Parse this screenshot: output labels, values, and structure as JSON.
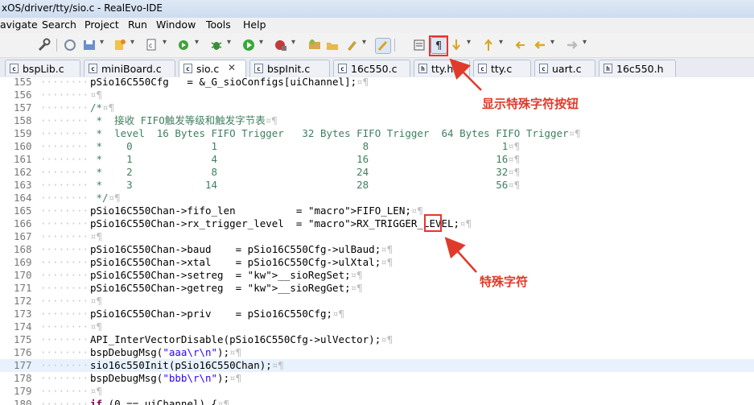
{
  "window": {
    "title": "xOS/driver/tty/sio.c - RealEvo-IDE"
  },
  "menu": [
    "avigate",
    "Search",
    "Project",
    "Run",
    "Window",
    "Tools",
    "Help"
  ],
  "toolbar": {
    "icons": [
      "wrench-icon",
      "save-icon",
      "new-icon",
      "copy-icon",
      "refresh-icon",
      "bug-icon",
      "run-icon",
      "record-icon",
      "package-icon",
      "open-icon",
      "paint-icon",
      "pen-icon",
      "block-icon",
      "pilcrow-icon",
      "arrow-down-icon",
      "nav-icon",
      "back-icon",
      "forward-icon",
      "forward-disabled-icon"
    ]
  },
  "tabs": [
    {
      "label": "bspLib.c",
      "type": "c",
      "close": false
    },
    {
      "label": "miniBoard.c",
      "type": "c",
      "close": false
    },
    {
      "label": "sio.c",
      "type": "c",
      "close": true,
      "active": true
    },
    {
      "label": "bspInit.c",
      "type": "c",
      "close": false
    },
    {
      "label": "16c550.c",
      "type": "c",
      "close": false
    },
    {
      "label": "tty.h",
      "type": "h",
      "close": false
    },
    {
      "label": "tty.c",
      "type": "c",
      "close": false
    },
    {
      "label": "uart.c",
      "type": "c",
      "close": false
    },
    {
      "label": "16c550.h",
      "type": "h",
      "close": false
    }
  ],
  "code_lines": [
    {
      "n": "155",
      "t": "pSio16C550Cfg   = &_G_sioConfigs[uiChannel];"
    },
    {
      "n": "156",
      "t": ""
    },
    {
      "n": "157",
      "t": "/*"
    },
    {
      "n": "158",
      "t": " *  接收 FIFO触发等级和触发字节表"
    },
    {
      "n": "159",
      "t": " *  level  16 Bytes FIFO Trigger   32 Bytes FIFO Trigger  64 Bytes FIFO Trigger"
    },
    {
      "n": "160",
      "t": " *    0             1                        8                      1"
    },
    {
      "n": "161",
      "t": " *    1             4                       16                     16"
    },
    {
      "n": "162",
      "t": " *    2             8                       24                     32"
    },
    {
      "n": "163",
      "t": " *    3            14                       28                     56"
    },
    {
      "n": "164",
      "t": " */"
    },
    {
      "n": "165",
      "t": "pSio16C550Chan->fifo_len          = FIFO_LEN;"
    },
    {
      "n": "166",
      "t": "pSio16C550Chan->rx_trigger_level  = RX_TRIGGER_LEVEL;"
    },
    {
      "n": "167",
      "t": ""
    },
    {
      "n": "168",
      "t": "pSio16C550Chan->baud    = pSio16C550Cfg->ulBaud;"
    },
    {
      "n": "169",
      "t": "pSio16C550Chan->xtal    = pSio16C550Cfg->ulXtal;"
    },
    {
      "n": "170",
      "t": "pSio16C550Chan->setreg  = __sioRegSet;"
    },
    {
      "n": "171",
      "t": "pSio16C550Chan->getreg  = __sioRegGet;"
    },
    {
      "n": "172",
      "t": ""
    },
    {
      "n": "173",
      "t": "pSio16C550Chan->priv    = pSio16C550Cfg;"
    },
    {
      "n": "174",
      "t": ""
    },
    {
      "n": "175",
      "t": "API_InterVectorDisable(pSio16C550Cfg->ulVector);"
    },
    {
      "n": "176",
      "t": "bspDebugMsg(\"aaa\\r\\n\");"
    },
    {
      "n": "177",
      "t": "sio16c550Init(pSio16C550Chan);"
    },
    {
      "n": "178",
      "t": "bspDebugMsg(\"bbb\\r\\n\");"
    },
    {
      "n": "179",
      "t": ""
    },
    {
      "n": "180",
      "t": "if (0 == uiChannel) {"
    }
  ],
  "annotations": {
    "toolbar_button_label": "显示特殊字符按钮",
    "special_char_label": "特殊字符"
  },
  "colors": {
    "annotation_red": "#e03a2a",
    "comment_green": "#3f7f5f",
    "macro_magenta": "#d100d1",
    "keyword": "#7f0055",
    "current_line": "#e8f2fe"
  }
}
